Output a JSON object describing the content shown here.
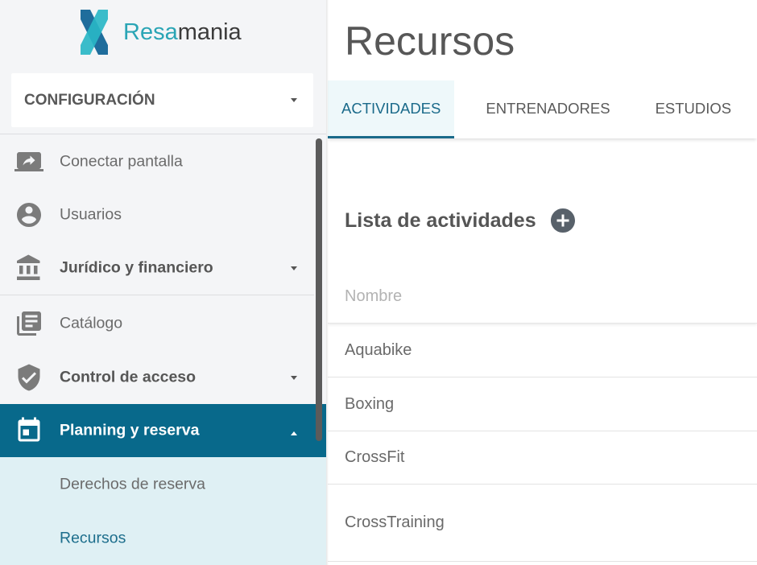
{
  "app": {
    "logo": {
      "part1": "Resa",
      "part2": "mania",
      "icon": "resamania-logo-icon"
    }
  },
  "theme": {
    "brand_teal": "#2aa5b5",
    "active_bg": "#08698b",
    "submenu_bg": "#dff0f4",
    "tab_active": "#1a6a8a"
  },
  "sidebar": {
    "section_selector": {
      "label": "CONFIGURACIÓN",
      "icon": "chevron-down-icon"
    },
    "items": [
      {
        "label": "Conectar pantalla",
        "icon": "screen-share-icon"
      },
      {
        "label": "Usuarios",
        "icon": "account-circle-icon"
      },
      {
        "label": "Jurídico y financiero",
        "icon": "bank-icon",
        "expandable": true
      },
      {
        "label": "Catálogo",
        "icon": "library-books-icon"
      },
      {
        "label": "Control de acceso",
        "icon": "shield-check-icon",
        "expandable": true
      },
      {
        "label": "Planning y reserva",
        "icon": "calendar-icon",
        "expandable": true,
        "expanded": true,
        "active": true,
        "children": [
          {
            "label": "Derechos de reserva"
          },
          {
            "label": "Recursos",
            "active": true
          }
        ]
      }
    ]
  },
  "main": {
    "title": "Recursos",
    "tabs": [
      {
        "label": "ACTIVIDADES",
        "active": true
      },
      {
        "label": "ENTRENADORES"
      },
      {
        "label": "ESTUDIOS"
      }
    ],
    "list": {
      "title": "Lista de actividades",
      "add_icon": "add-circle-icon",
      "column_header": "Nombre",
      "rows": [
        "Aquabike",
        "Boxing",
        "CrossFit",
        "CrossTraining"
      ]
    }
  }
}
